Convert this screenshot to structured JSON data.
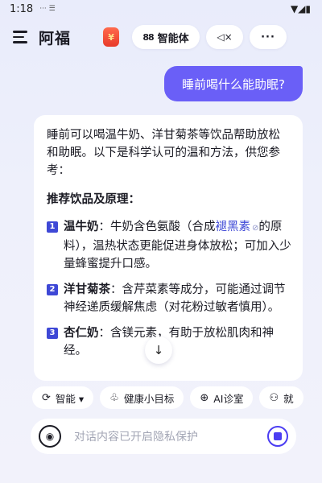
{
  "status_bar": {
    "time": "1:18",
    "left_icons": "··· ☰",
    "right_icons": "▼◢▮"
  },
  "top_bar": {
    "title": "阿福",
    "gift_badge": "¥",
    "agent_label": "智能体",
    "agent_icon": "88",
    "speaker_label": "◁×",
    "more_label": "···"
  },
  "conversation": {
    "user_message": "睡前喝什么能助眠?",
    "answer": {
      "intro": "睡前可以喝温牛奶、洋甘菊茶等饮品帮助放松和助眠。以下是科学认可的温和方法，供您参考：",
      "section_title": "推荐饮品及原理：",
      "items": [
        {
          "num": "1",
          "name": "温牛奶",
          "text_before": "：牛奶含色氨酸（合成",
          "link_text": "褪黑素",
          "link_icon": "link-icon",
          "text_after": "的原料），温热状态更能促进身体放松；可加入少量蜂蜜提升口感。"
        },
        {
          "num": "2",
          "name": "洋甘菊茶",
          "text_before": "：含芹菜素等成分，可能通过调节神经递质缓解焦虑（对花粉过敏者慎用）。",
          "link_text": "",
          "text_after": ""
        },
        {
          "num": "3",
          "name": "杏仁奶",
          "text_before": "：含镁元素，有助于放松肌肉和神经。",
          "link_text": "",
          "text_after": ""
        }
      ]
    }
  },
  "scroll_down": "↓",
  "chips": [
    {
      "icon": "⟳",
      "label": "智能 ▾"
    },
    {
      "icon": "♧",
      "label": "健康小目标"
    },
    {
      "icon": "⊕",
      "label": "AI诊室"
    },
    {
      "icon": "⚇",
      "label": "就"
    }
  ],
  "input": {
    "placeholder": "对话内容已开启隐私保护",
    "voice_icon": "◉"
  },
  "colors": {
    "accent": "#6a5ff7",
    "badge": "#3e48d6",
    "send": "#4b3df2"
  }
}
